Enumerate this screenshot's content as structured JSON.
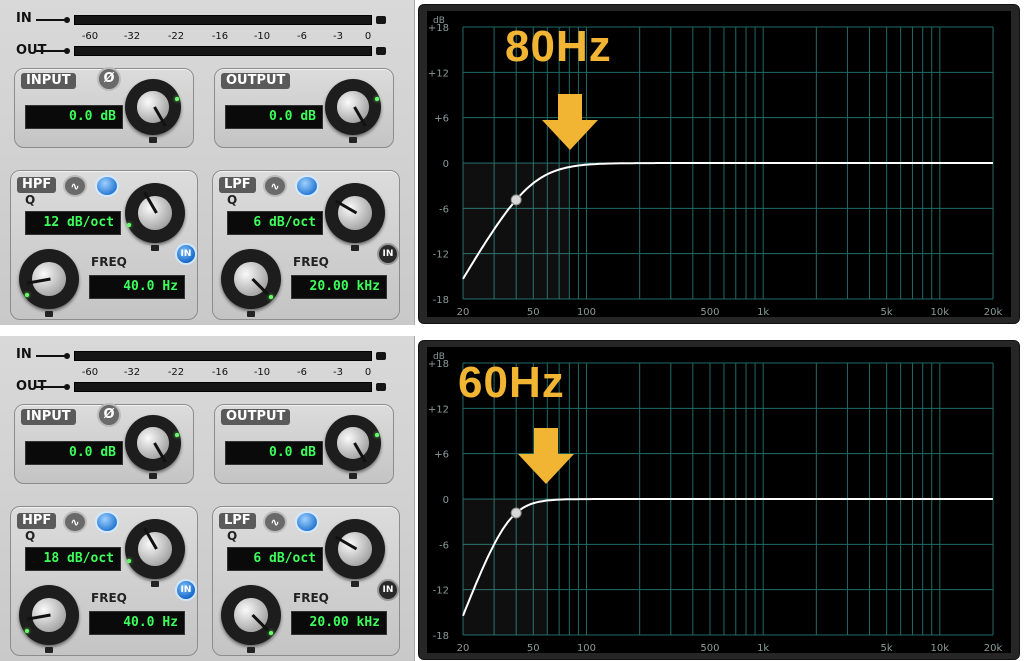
{
  "meter": {
    "in_label": "IN",
    "out_label": "OUT",
    "scale": [
      "-60",
      "-32",
      "-22",
      "-16",
      "-10",
      "-6",
      "-3",
      "0"
    ]
  },
  "input": {
    "title": "INPUT",
    "value": "0.0 dB",
    "phase_icon": "Ø"
  },
  "output": {
    "title": "OUTPUT",
    "value": "0.0 dB"
  },
  "hpf": {
    "title": "HPF",
    "q_label": "Q",
    "freq_label": "FREQ",
    "freq_value": "40.0 Hz",
    "in_label": "IN"
  },
  "lpf": {
    "title": "LPF",
    "q_label": "Q",
    "freq_label": "FREQ",
    "freq_value": "20.00 kHz",
    "in_label": "IN"
  },
  "panels": [
    {
      "hpf_slope": "12 dB/oct",
      "lpf_slope": "6 dB/oct",
      "annotation": "80Hz"
    },
    {
      "hpf_slope": "18 dB/oct",
      "lpf_slope": "6 dB/oct",
      "annotation": "60Hz"
    }
  ],
  "graph": {
    "db_unit": "dB",
    "db_labels": [
      "+18",
      "+12",
      "+6",
      "0",
      "-6",
      "-12",
      "-18"
    ],
    "freq_labels": [
      "20",
      "50",
      "100",
      "500",
      "1k",
      "5k",
      "10k",
      "20k"
    ]
  },
  "colors": {
    "annotation": "#f2b433",
    "lcd_text": "#3cff5a",
    "grid": "#1f6b66",
    "curve": "#ffffff"
  }
}
